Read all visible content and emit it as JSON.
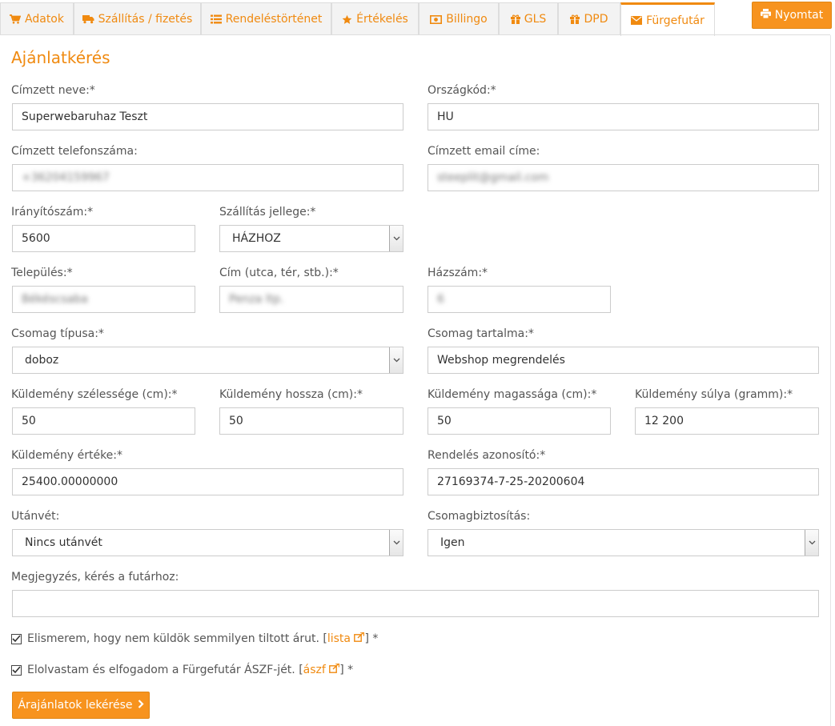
{
  "tabs": [
    {
      "label": "Adatok",
      "icon": "cart-icon"
    },
    {
      "label": "Szállítás / fizetés",
      "icon": "truck-icon"
    },
    {
      "label": "Rendeléstörténet",
      "icon": "list-icon"
    },
    {
      "label": "Értékelés",
      "icon": "star-icon"
    },
    {
      "label": "Billingo",
      "icon": "money-icon"
    },
    {
      "label": "GLS",
      "icon": "gift-icon"
    },
    {
      "label": "DPD",
      "icon": "gift-icon"
    },
    {
      "label": "Fürgefutár",
      "icon": "envelope-icon",
      "active": true
    }
  ],
  "print_button": {
    "label": "Nyomtat",
    "icon": "printer-icon"
  },
  "form": {
    "title": "Ajánlatkérés",
    "recipient_name": {
      "label": "Címzett neve:*",
      "value": "Superwebaruhaz Teszt"
    },
    "country_code": {
      "label": "Országkód:*",
      "value": "HU"
    },
    "recipient_phone": {
      "label": "Címzett telefonszáma:",
      "value": "+36204159967"
    },
    "recipient_email": {
      "label": "Címzett email címe:",
      "value": "steeplit@gmail.com"
    },
    "zip": {
      "label": "Irányítószám:*",
      "value": "5600"
    },
    "delivery_type": {
      "label": "Szállítás jellege:*",
      "value": "HÁZHOZ"
    },
    "city": {
      "label": "Település:*",
      "value": "Békéscsaba"
    },
    "address": {
      "label": "Cím (utca, tér, stb.):*",
      "value": "Penza ltp."
    },
    "house_number": {
      "label": "Házszám:*",
      "value": "6"
    },
    "package_type": {
      "label": "Csomag típusa:*",
      "value": "doboz"
    },
    "package_content": {
      "label": "Csomag tartalma:*",
      "value": "Webshop megrendelés"
    },
    "width": {
      "label": "Küldemény szélessége (cm):*",
      "value": "50"
    },
    "length": {
      "label": "Küldemény hossza (cm):*",
      "value": "50"
    },
    "height": {
      "label": "Küldemény magassága (cm):*",
      "value": "50"
    },
    "weight": {
      "label": "Küldemény súlya (gramm):*",
      "value": "12 200"
    },
    "value": {
      "label": "Küldemény értéke:*",
      "value": "25400.00000000"
    },
    "order_id": {
      "label": "Rendelés azonosító:*",
      "value": "27169374-7-25-20200604"
    },
    "cod": {
      "label": "Utánvét:",
      "value": "Nincs utánvét"
    },
    "insurance": {
      "label": "Csomagbiztosítás:",
      "value": "Igen"
    },
    "note": {
      "label": "Megjegyzés, kérés a futárhoz:",
      "value": ""
    },
    "checkbox1": {
      "before": "Elismerem, hogy nem küldök semmilyen tiltott árut. [",
      "link": "lista",
      "after": "] *"
    },
    "checkbox2": {
      "before": "Elolvastam és elfogadom a Fürgefutár ÁSZF-jét. [",
      "link": "ászf",
      "after": "] *"
    },
    "submit_label": "Árajánlatok lekérése"
  },
  "colors": {
    "accent": "#f08a10",
    "button": "#f7931e",
    "border": "#cccccc"
  }
}
